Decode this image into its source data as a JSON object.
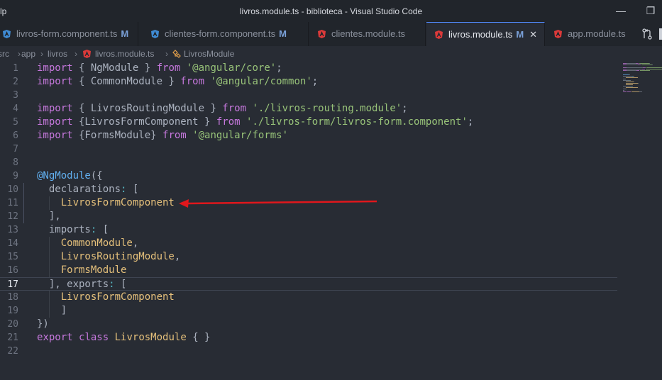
{
  "titlebar": {
    "menu_fragment": "lp",
    "title": "livros.module.ts - biblioteca - Visual Studio Code",
    "restore_glyph": "❐",
    "minimize_glyph": "—"
  },
  "tabs": [
    {
      "label": "livros-form.component.ts",
      "modified": "M",
      "icon": "angular-component-icon",
      "active": false
    },
    {
      "label": "clientes-form.component.ts",
      "modified": "M",
      "icon": "angular-component-icon",
      "active": false
    },
    {
      "label": "clientes.module.ts",
      "modified": "",
      "icon": "angular-module-icon",
      "active": false
    },
    {
      "label": "livros.module.ts",
      "modified": "M",
      "icon": "angular-module-icon",
      "active": true,
      "close": "✕"
    },
    {
      "label": "app.module.ts",
      "modified": "",
      "icon": "angular-module-icon",
      "active": false
    }
  ],
  "breadcrumb": {
    "items": [
      "src",
      "app",
      "livros",
      "livros.module.ts",
      "LivrosModule"
    ]
  },
  "editor": {
    "current_line": "17",
    "lines": [
      {
        "n": "1",
        "tokens": [
          [
            "kw",
            "import"
          ],
          [
            "p",
            " { NgModule } "
          ],
          [
            "kw",
            "from"
          ],
          [
            "p",
            " "
          ],
          [
            "str",
            "'@angular/core'"
          ],
          [
            "p",
            ";"
          ]
        ]
      },
      {
        "n": "2",
        "tokens": [
          [
            "kw",
            "import"
          ],
          [
            "p",
            " { CommonModule } "
          ],
          [
            "kw",
            "from"
          ],
          [
            "p",
            " "
          ],
          [
            "str",
            "'@angular/common'"
          ],
          [
            "p",
            ";"
          ]
        ]
      },
      {
        "n": "3",
        "tokens": []
      },
      {
        "n": "4",
        "tokens": [
          [
            "kw",
            "import"
          ],
          [
            "p",
            " { LivrosRoutingModule } "
          ],
          [
            "kw",
            "from"
          ],
          [
            "p",
            " "
          ],
          [
            "str",
            "'./livros-routing.module'"
          ],
          [
            "p",
            ";"
          ]
        ]
      },
      {
        "n": "5",
        "tokens": [
          [
            "kw",
            "import"
          ],
          [
            "p",
            " {LivrosFormComponent } "
          ],
          [
            "kw",
            "from"
          ],
          [
            "p",
            " "
          ],
          [
            "str",
            "'./livros-form/livros-form.component'"
          ],
          [
            "p",
            ";"
          ]
        ]
      },
      {
        "n": "6",
        "tokens": [
          [
            "kw",
            "import"
          ],
          [
            "p",
            " {FormsModule} "
          ],
          [
            "kw",
            "from"
          ],
          [
            "p",
            " "
          ],
          [
            "str",
            "'@angular/forms'"
          ]
        ]
      },
      {
        "n": "7",
        "tokens": []
      },
      {
        "n": "8",
        "tokens": []
      },
      {
        "n": "9",
        "tokens": [
          [
            "dec",
            "@NgModule"
          ],
          [
            "p",
            "({"
          ]
        ]
      },
      {
        "n": "10",
        "tokens": [
          [
            "p",
            "  declarations"
          ],
          [
            "op",
            ":"
          ],
          [
            "p",
            " ["
          ]
        ]
      },
      {
        "n": "11",
        "tokens": [
          [
            "p",
            "    "
          ],
          [
            "cls",
            "LivrosFormComponent"
          ]
        ]
      },
      {
        "n": "12",
        "tokens": [
          [
            "p",
            "  ],"
          ]
        ]
      },
      {
        "n": "13",
        "tokens": [
          [
            "p",
            "  imports"
          ],
          [
            "op",
            ":"
          ],
          [
            "p",
            " ["
          ]
        ]
      },
      {
        "n": "14",
        "tokens": [
          [
            "p",
            "    "
          ],
          [
            "cls",
            "CommonModule"
          ],
          [
            "p",
            ","
          ]
        ]
      },
      {
        "n": "15",
        "tokens": [
          [
            "p",
            "    "
          ],
          [
            "cls",
            "LivrosRoutingModule"
          ],
          [
            "p",
            ","
          ]
        ]
      },
      {
        "n": "16",
        "tokens": [
          [
            "p",
            "    "
          ],
          [
            "cls",
            "FormsModule"
          ]
        ]
      },
      {
        "n": "17",
        "tokens": [
          [
            "p",
            "  ], exports"
          ],
          [
            "op",
            ":"
          ],
          [
            "p",
            " ["
          ]
        ]
      },
      {
        "n": "18",
        "tokens": [
          [
            "p",
            "    "
          ],
          [
            "cls",
            "LivrosFormComponent"
          ]
        ]
      },
      {
        "n": "19",
        "tokens": [
          [
            "p",
            "    ]"
          ]
        ]
      },
      {
        "n": "20",
        "tokens": [
          [
            "p",
            "})"
          ]
        ]
      },
      {
        "n": "21",
        "tokens": [
          [
            "kw",
            "export"
          ],
          [
            "p",
            " "
          ],
          [
            "kw",
            "class"
          ],
          [
            "p",
            " "
          ],
          [
            "cls",
            "LivrosModule"
          ],
          [
            "p",
            " { }"
          ]
        ]
      },
      {
        "n": "22",
        "tokens": []
      }
    ]
  },
  "annotation": {
    "arrow_color": "#e0171c",
    "points_to_line": "11"
  },
  "colors": {
    "accent": "#528bff",
    "editor_bg": "#282c34",
    "chrome_bg": "#21252b"
  }
}
